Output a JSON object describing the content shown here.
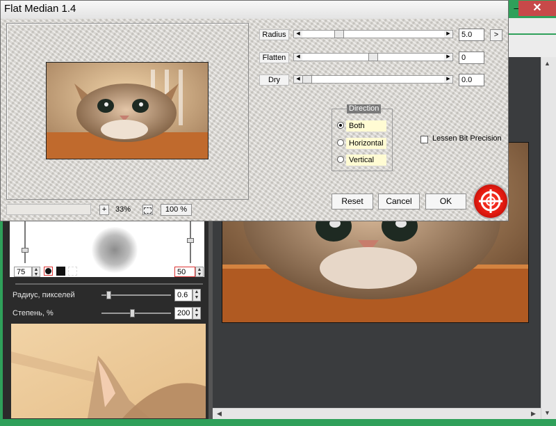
{
  "dialog": {
    "title": "Flat Median 1.4",
    "zoom": {
      "plus_label": "+",
      "percent": "33%",
      "full_label": "100 %"
    },
    "params": [
      {
        "label": "Radius",
        "value": "5.0",
        "level": 0.14
      },
      {
        "label": "Flatten",
        "value": "0",
        "level": 0.5
      },
      {
        "label": "Dry",
        "value": "0.0",
        "level": 0.0
      }
    ],
    "expand_label": ">",
    "direction": {
      "title": "Direction",
      "options": [
        "Both",
        "Horizontal",
        "Vertical"
      ],
      "selected": "Both"
    },
    "lessen_bit_precision": {
      "label": "Lessen Bit Precision",
      "checked": false
    },
    "buttons": {
      "reset": "Reset",
      "cancel": "Cancel",
      "ok": "OK"
    }
  },
  "host": {
    "window_controls": {
      "minimize": "–",
      "close": "✕"
    },
    "brush": {
      "left_value": "75",
      "right_value": "50"
    },
    "radius": {
      "label": "Радиус, пикселей",
      "value": "0.6"
    },
    "strength": {
      "label": "Степень, %",
      "value": "200"
    }
  },
  "colors": {
    "accent_green": "#2fa05a",
    "close_red": "#c74949",
    "radio_highlight": "#fffbd3",
    "logo_red": "#e21a10"
  },
  "icons": [
    "cat-photo-preview",
    "plugin-logo-icon",
    "spin-up-icon",
    "spin-down-icon",
    "brush-circle-icon",
    "brush-square-icon",
    "selection-icon"
  ]
}
